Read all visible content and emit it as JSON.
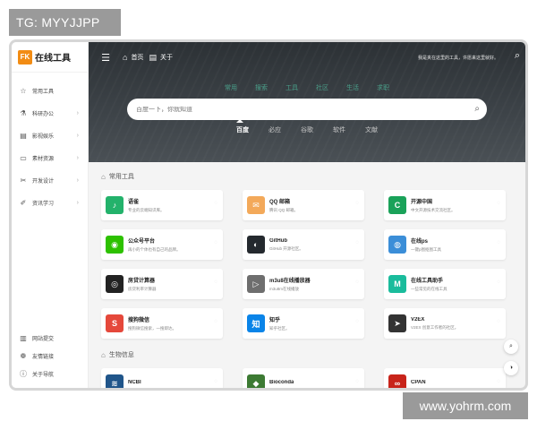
{
  "tg_badge": "TG: MYYJJPP",
  "watermark": "www.yohrm.com",
  "logo": {
    "mark": "FK",
    "text": "在线工具"
  },
  "sidebar": {
    "items": [
      {
        "icon": "☆",
        "label": "常用工具",
        "arrow": ""
      },
      {
        "icon": "⚗",
        "label": "科研办公",
        "arrow": "›"
      },
      {
        "icon": "▤",
        "label": "影视娱乐",
        "arrow": "›"
      },
      {
        "icon": "▭",
        "label": "素材资源",
        "arrow": "›"
      },
      {
        "icon": "✂",
        "label": "开发设计",
        "arrow": "›"
      },
      {
        "icon": "✐",
        "label": "资讯学习",
        "arrow": "›"
      }
    ],
    "bottom_items": [
      {
        "icon": "▥",
        "label": "网站提交"
      },
      {
        "icon": "❁",
        "label": "友情链接"
      },
      {
        "icon": "ⓘ",
        "label": "关于导航"
      }
    ]
  },
  "topbar": {
    "home_label": "首页",
    "about_label": "关于",
    "message": "我是夹在这里的工具，许愿来这里就好。"
  },
  "hero": {
    "categories": [
      "常用",
      "搜索",
      "工具",
      "社区",
      "生活",
      "求职"
    ],
    "search_placeholder": "百度一下，你就知道",
    "engines": [
      "百度",
      "必应",
      "谷歌",
      "软件",
      "文献"
    ],
    "active_engine_index": 0
  },
  "sections": [
    {
      "title": "常用工具",
      "cards": [
        {
          "name": "语雀",
          "desc": "专业的云端知识库。",
          "icon_char": "♪",
          "icon_bg": "#23b26b"
        },
        {
          "name": "QQ 邮箱",
          "desc": "腾讯 QQ 邮箱。",
          "icon_char": "✉",
          "icon_bg": "#f3a95a"
        },
        {
          "name": "开源中国",
          "desc": "中文开源技术交流社区。",
          "icon_char": "C",
          "icon_bg": "#1aa259"
        },
        {
          "name": "公众号平台",
          "desc": "再小的个体也有自己的品牌。",
          "icon_char": "◉",
          "icon_bg": "#2dc100"
        },
        {
          "name": "GitHub",
          "desc": "GitHub 开源社区。",
          "icon_char": "◐",
          "icon_bg": "#24292e"
        },
        {
          "name": "在线ps",
          "desc": "一键p图抠图工具",
          "icon_char": "◍",
          "icon_bg": "#3b8ed8"
        },
        {
          "name": "房贷计算器",
          "desc": "房贷利率计算器",
          "icon_char": "◎",
          "icon_bg": "#222222"
        },
        {
          "name": "m3u8在线播放器",
          "desc": "m3u8m在线播放",
          "icon_char": "▷",
          "icon_bg": "#6e6e6e"
        },
        {
          "name": "在线工具助手",
          "desc": "一些常见的在线工具",
          "icon_char": "M",
          "icon_bg": "#1abc9c"
        },
        {
          "name": "搜狗微信",
          "desc": "搜狗微信搜索，一搜即达。",
          "icon_char": "S",
          "icon_bg": "#e5483b"
        },
        {
          "name": "知乎",
          "desc": "知乎社区。",
          "icon_char": "知",
          "icon_bg": "#0a84e8"
        },
        {
          "name": "V2EX",
          "desc": "V2EX 创意工作者的社区。",
          "icon_char": "➤",
          "icon_bg": "#333333"
        }
      ]
    },
    {
      "title": "生物信息",
      "cards": [
        {
          "name": "NCBI",
          "desc": "",
          "icon_char": "≋",
          "icon_bg": "#20558a"
        },
        {
          "name": "Bioconda",
          "desc": "",
          "icon_char": "◆",
          "icon_bg": "#3c7a33"
        },
        {
          "name": "CPAN",
          "desc": "",
          "icon_char": "∞",
          "icon_bg": "#c8241a"
        }
      ]
    }
  ],
  "float_buttons": {
    "search": "⌕",
    "theme": "◑"
  },
  "colors": {
    "accent": "#f28c14",
    "hero_bg": "#33393e",
    "category_text": "#4aa08a"
  }
}
